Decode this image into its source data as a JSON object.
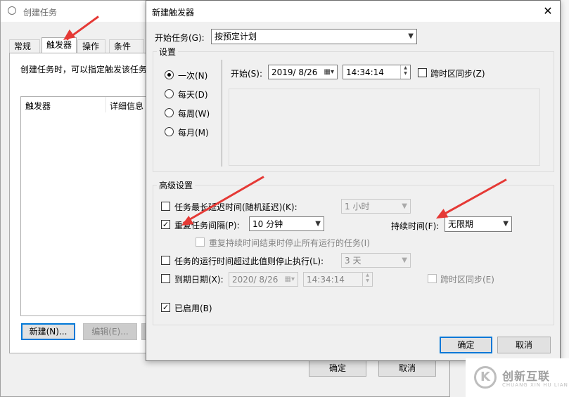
{
  "background_window": {
    "title": "创建任务",
    "tabs": [
      "常规",
      "触发器",
      "操作",
      "条件"
    ],
    "active_tab": "触发器",
    "description": "创建任务时，可以指定触发该任务",
    "grid_headers": [
      "触发器",
      "详细信息"
    ],
    "new_button": "新建(N)...",
    "edit_button": "编辑(E)...",
    "ok_button": "确定",
    "cancel_button": "取消"
  },
  "dialog": {
    "title": "新建触发器",
    "close_glyph": "✕",
    "begin_task_label": "开始任务(G):",
    "begin_task_value": "按预定计划",
    "settings_group": "设置",
    "schedule_options": [
      {
        "label": "一次(N)",
        "selected": true
      },
      {
        "label": "每天(D)",
        "selected": false
      },
      {
        "label": "每周(W)",
        "selected": false
      },
      {
        "label": "每月(M)",
        "selected": false
      }
    ],
    "start_label": "开始(S):",
    "start_date": "2019/ 8/26",
    "start_time": "14:34:14",
    "sync_timezone_label": "跨时区同步(Z)",
    "advanced_group": "高级设置",
    "delay_label": "任务最长延迟时间(随机延迟)(K):",
    "delay_value": "1 小时",
    "repeat_label": "重复任务间隔(P):",
    "repeat_value": "10 分钟",
    "duration_label": "持续时间(F):",
    "duration_value": "无限期",
    "stop_at_end_label": "重复持续时间结束时停止所有运行的任务(I)",
    "stop_if_runs_label": "任务的运行时间超过此值则停止执行(L):",
    "stop_if_runs_value": "3 天",
    "expire_label": "到期日期(X):",
    "expire_date": "2020/ 8/26",
    "expire_time": "14:34:14",
    "expire_sync_label": "跨时区同步(E)",
    "enabled_label": "已启用(B)",
    "ok_button": "确定",
    "cancel_button": "取消"
  },
  "watermark": {
    "logo_glyph": "K",
    "name": "创新互联",
    "subtitle": "CHUANG XIN HU LIAN"
  },
  "colors": {
    "annotation": "#e53935",
    "focus": "#0078d7"
  }
}
